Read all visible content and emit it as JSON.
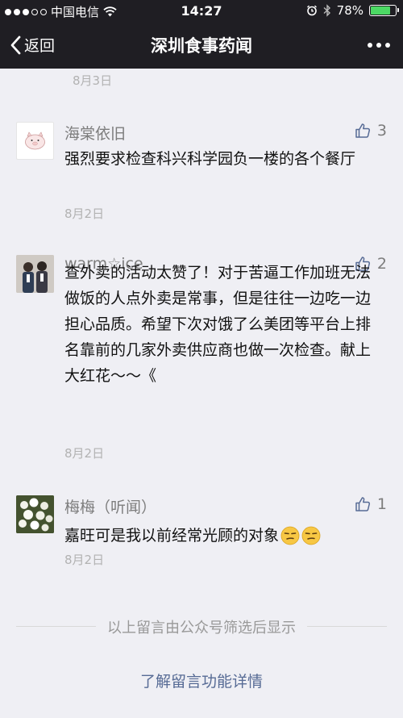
{
  "status_bar": {
    "carrier": "中国电信",
    "time": "14:27",
    "battery": "78%",
    "battery_level": 0.78
  },
  "nav": {
    "back_label": "返回",
    "title": "深圳食事药闻"
  },
  "top_date": "8月3日",
  "comments": [
    {
      "name": "海棠依旧",
      "likes": "3",
      "text": "强烈要求检查科兴科学园负一楼的各个餐厅",
      "date": "8月2日",
      "avatar": "pig-avatar"
    },
    {
      "name": "warm☆ice",
      "likes": "2",
      "text": "查外卖的活动太赞了！对于苦逼工作加班无法做饭的人点外卖是常事，但是往往一边吃一边担心品质。希望下次对饿了么美团等平台上排名靠前的几家外卖供应商也做一次检查。献上大红花～～《",
      "date": "8月2日",
      "avatar": "couple-photo-avatar"
    },
    {
      "name": "梅梅（听闻）",
      "likes": "1",
      "text": "嘉旺可是我以前经常光顾的对象",
      "date": "8月2日",
      "avatar": "flowers-avatar",
      "emojis": [
        "smirk-emoji",
        "smirk-emoji"
      ]
    }
  ],
  "footer": {
    "filter_note": "以上留言由公众号筛选后显示",
    "learn_more": "了解留言功能详情"
  },
  "colors": {
    "background": "#efeff4",
    "topbar": "#1f1e23",
    "link": "#576b95",
    "meta_text": "#7d7d7d"
  }
}
